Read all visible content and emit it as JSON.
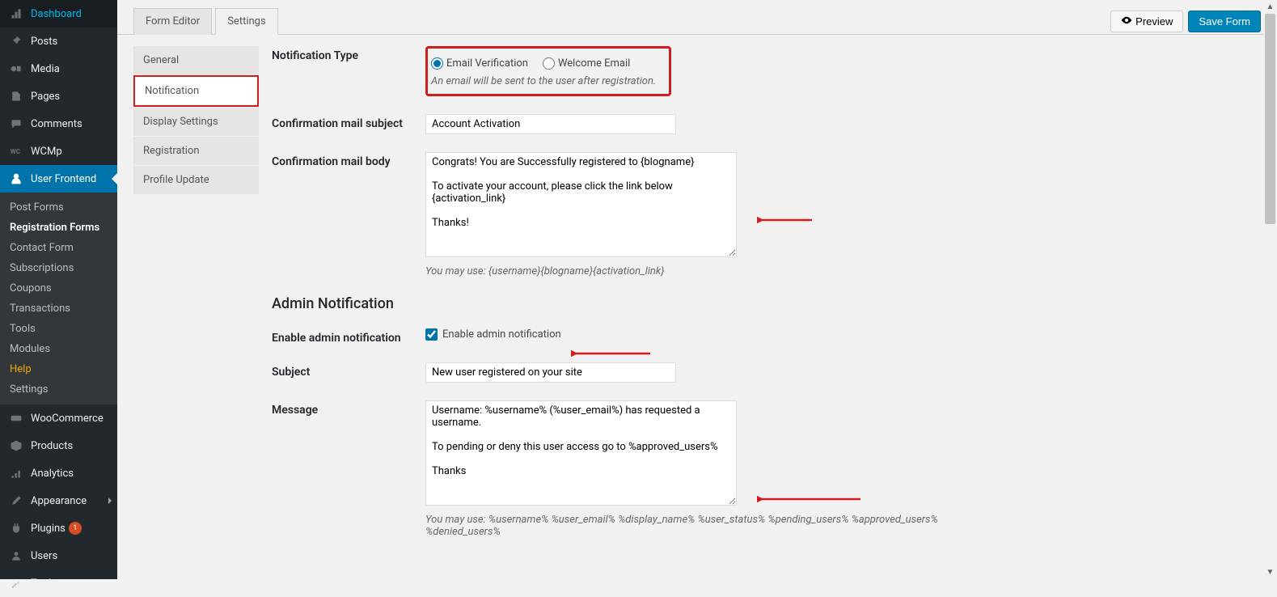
{
  "admin_menu": {
    "items": [
      {
        "key": "dashboard",
        "label": "Dashboard"
      },
      {
        "key": "posts",
        "label": "Posts"
      },
      {
        "key": "media",
        "label": "Media"
      },
      {
        "key": "pages",
        "label": "Pages"
      },
      {
        "key": "comments",
        "label": "Comments"
      },
      {
        "key": "wcmp",
        "label": "WCMp"
      },
      {
        "key": "user-frontend",
        "label": "User Frontend",
        "active": true
      }
    ],
    "frontend_submenu": [
      {
        "label": "Post Forms"
      },
      {
        "label": "Registration Forms",
        "current": true
      },
      {
        "label": "Contact Form"
      },
      {
        "label": "Subscriptions"
      },
      {
        "label": "Coupons"
      },
      {
        "label": "Transactions"
      },
      {
        "label": "Tools"
      },
      {
        "label": "Modules"
      },
      {
        "label": "Help",
        "help": true
      },
      {
        "label": "Settings"
      }
    ],
    "bottom": [
      {
        "key": "woocommerce",
        "label": "WooCommerce"
      },
      {
        "key": "products",
        "label": "Products"
      },
      {
        "key": "analytics",
        "label": "Analytics"
      }
    ],
    "bottom2": [
      {
        "key": "appearance",
        "label": "Appearance"
      },
      {
        "key": "plugins",
        "label": "Plugins",
        "badge": "1"
      },
      {
        "key": "users",
        "label": "Users"
      },
      {
        "key": "tools",
        "label": "Tools"
      }
    ]
  },
  "toolbar": {
    "tabs": [
      {
        "label": "Form Editor"
      },
      {
        "label": "Settings",
        "active": true
      }
    ],
    "preview": "Preview",
    "save": "Save Form"
  },
  "settings_nav": [
    {
      "label": "General"
    },
    {
      "label": "Notification",
      "active": true
    },
    {
      "label": "Display Settings"
    },
    {
      "label": "Registration"
    },
    {
      "label": "Profile Update"
    }
  ],
  "form": {
    "notification_type_label": "Notification Type",
    "radio_email": "Email Verification",
    "radio_welcome": "Welcome Email",
    "radio_hint": "An email will be sent to the user after registration.",
    "conf_subject_label": "Confirmation mail subject",
    "conf_subject_value": "Account Activation",
    "conf_body_label": "Confirmation mail body",
    "conf_body_value": "Congrats! You are Successfully registered to {blogname}\n\nTo activate your account, please click the link below\n{activation_link}\n\nThanks!",
    "conf_body_hint": "You may use: {username}{blogname}{activation_link}",
    "admin_section": "Admin Notification",
    "enable_admin_label": "Enable admin notification",
    "enable_admin_cb": "Enable admin notification",
    "admin_subject_label": "Subject",
    "admin_subject_value": "New user registered on your site",
    "admin_msg_label": "Message",
    "admin_msg_value": "Username: %username% (%user_email%) has requested a username.\n\nTo pending or deny this user access go to %approved_users%\n\nThanks",
    "admin_msg_hint": "You may use: %username% %user_email% %display_name% %user_status% %pending_users% %approved_users% %denied_users%"
  }
}
